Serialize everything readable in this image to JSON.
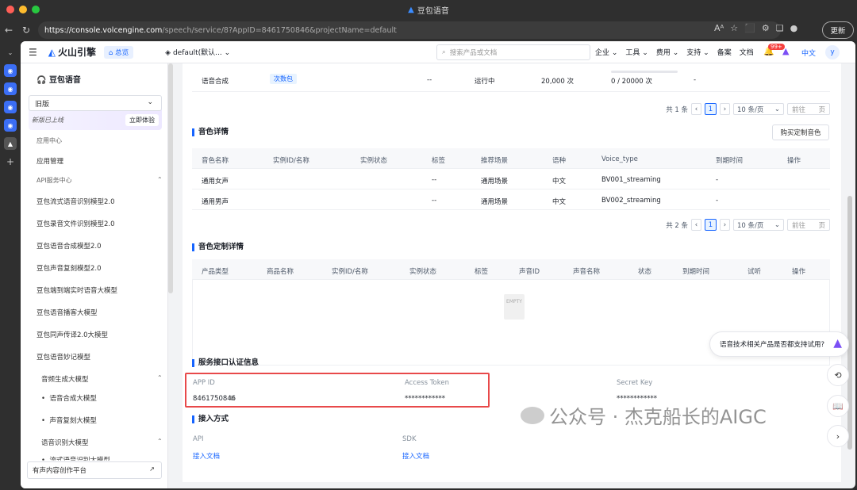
{
  "window": {
    "title": "豆包语音"
  },
  "browser": {
    "url_host": "https://console.volcengine.com",
    "url_path": "/speech/service/8?AppID=8461750846&projectName=default",
    "update_label": "更新"
  },
  "topnav": {
    "brand": "火山引擎",
    "overview": "总览",
    "project": "default(默认...",
    "search_placeholder": "搜索产品或文档",
    "menus": [
      "企业",
      "工具",
      "费用",
      "支持",
      "备案",
      "文档"
    ],
    "badge": "99+",
    "lang": "中文",
    "avatar": "y"
  },
  "sidebar": {
    "title": "豆包语音",
    "version": "旧版",
    "new_text": "新版已上线",
    "try_label": "立即体验",
    "app_center": "应用中心",
    "app_mgmt": "应用管理",
    "api_center": "API服务中心",
    "api_items": [
      "豆包流式语音识别模型2.0",
      "豆包录音文件识别模型2.0",
      "豆包语音合成模型2.0",
      "豆包声音复刻模型2.0",
      "豆包端到端实时语音大模型",
      "豆包语音播客大模型",
      "豆包同声传译2.0大模型",
      "豆包语音妙记模型"
    ],
    "audio_gen": "音频生成大模型",
    "audio_gen_items": [
      "语音合成大模型",
      "声音复刻大模型"
    ],
    "asr_group": "语音识别大模型",
    "asr_item": "流式语音识别大模型",
    "creator": "有声内容创作平台"
  },
  "svc_row": {
    "name": "语音合成",
    "tag": "次数包",
    "dash": "--",
    "status": "运行中",
    "amount": "20,000 次",
    "usage": "0 / 20000 次",
    "end": "-"
  },
  "pager1": {
    "total": "共 1 条",
    "page": "1",
    "size": "10 条/页",
    "goto": "前往",
    "unit": "页"
  },
  "voice": {
    "title": "音色详情",
    "buy": "购买定制音色",
    "headers": [
      "音色名称",
      "实例ID/名称",
      "实例状态",
      "标签",
      "推荐场景",
      "语种",
      "Voice_type",
      "到期时间",
      "操作"
    ],
    "rows": [
      [
        "通用女声",
        "",
        "",
        "--",
        "通用场景",
        "中文",
        "BV001_streaming",
        "-",
        ""
      ],
      [
        "通用男声",
        "",
        "",
        "--",
        "通用场景",
        "中文",
        "BV002_streaming",
        "-",
        ""
      ]
    ]
  },
  "pager2": {
    "total": "共 2 条",
    "page": "1",
    "size": "10 条/页",
    "goto": "前往",
    "unit": "页"
  },
  "custom": {
    "title": "音色定制详情",
    "headers": [
      "产品类型",
      "商品名称",
      "实例ID/名称",
      "实例状态",
      "标签",
      "声音ID",
      "声音名称",
      "状态",
      "到期时间",
      "试听",
      "操作"
    ],
    "empty": "EMPTY"
  },
  "auth": {
    "title": "服务接口认证信息",
    "app_id_label": "APP ID",
    "app_id": "8461750846",
    "token_label": "Access Token",
    "token": "************",
    "secret_label": "Secret Key",
    "secret": "************"
  },
  "access": {
    "title": "接入方式",
    "api_label": "API",
    "sdk_label": "SDK",
    "api_link": "接入文档",
    "sdk_link": "接入文档"
  },
  "help": {
    "question": "语音技术相关产品是否都支持试用?"
  },
  "watermark": {
    "text": "公众号 · 杰克船长的AIGC"
  }
}
